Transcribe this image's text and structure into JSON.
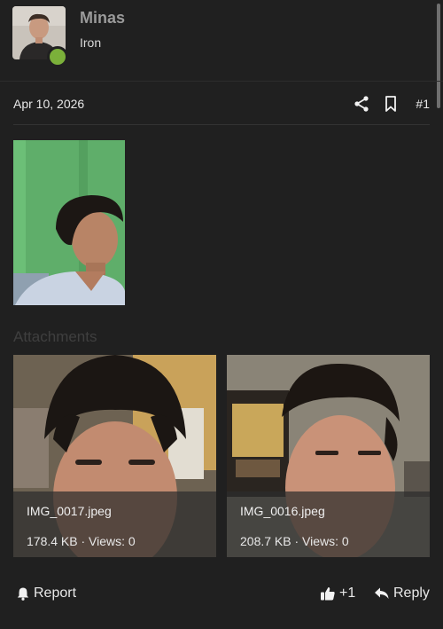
{
  "user": {
    "name": "Minas",
    "title": "Iron"
  },
  "post": {
    "date": "Apr 10, 2026",
    "number": "#1"
  },
  "icons": {
    "share": "share-icon",
    "bookmark": "bookmark-icon",
    "bell": "bell-icon",
    "thumbs_up": "thumbs-up-icon",
    "reply": "reply-icon"
  },
  "attachments": {
    "title": "Attachments",
    "items": [
      {
        "filename": "IMG_0017.jpeg",
        "info": "178.4 KB · Views: 0"
      },
      {
        "filename": "IMG_0016.jpeg",
        "info": "208.7 KB · Views: 0"
      }
    ]
  },
  "actions": {
    "report": "Report",
    "like": "+1",
    "reply": "Reply"
  },
  "colors": {
    "background": "#202020",
    "online": "#7bb03a",
    "muted_heading": "#3f3f3f"
  }
}
